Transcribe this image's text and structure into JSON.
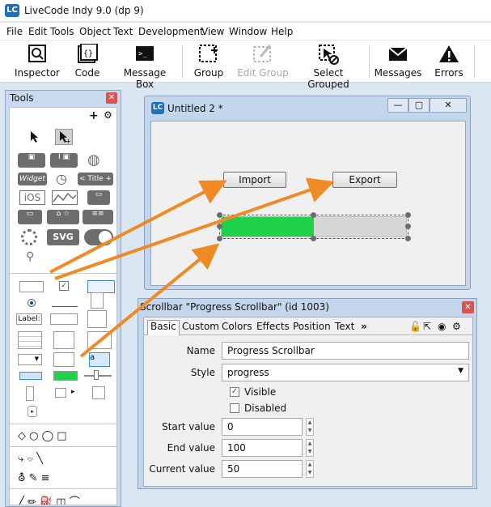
{
  "app": {
    "logo": "LC",
    "title": "LiveCode Indy 9.0 (dp 9)"
  },
  "menu": [
    "File",
    "Edit",
    "Tools",
    "Object",
    "Text",
    "Development",
    "View",
    "Window",
    "Help"
  ],
  "toolbar": [
    {
      "label": "Inspector",
      "icon": "inspector-icon",
      "enabled": true
    },
    {
      "label": "Code",
      "icon": "code-icon",
      "enabled": true
    },
    {
      "label": "Message Box",
      "icon": "message-box-icon",
      "enabled": true
    },
    {
      "label": "Group",
      "icon": "group-icon",
      "enabled": true
    },
    {
      "label": "Edit Group",
      "icon": "edit-group-icon",
      "enabled": false
    },
    {
      "label": "Select Grouped",
      "icon": "select-grouped-icon",
      "enabled": true
    },
    {
      "label": "Messages",
      "icon": "messages-icon",
      "enabled": true
    },
    {
      "label": "Errors",
      "icon": "errors-icon",
      "enabled": true
    }
  ],
  "tools": {
    "title": "Tools",
    "widget_label": "Widget",
    "title_label": "< Title +",
    "ios_label": "iOS",
    "svg_label": "SVG",
    "field_label": "Label:"
  },
  "stack": {
    "logo": "LC",
    "title": "Untitled 2 *",
    "import_label": "Import",
    "export_label": "Export",
    "progress": {
      "start": 0,
      "end": 100,
      "current": 50,
      "fill_color": "#1fd24a"
    }
  },
  "inspector": {
    "title": "Scrollbar \"Progress Scrollbar\" (id 1003)",
    "tabs": [
      "Basic",
      "Custom",
      "Colors",
      "Effects",
      "Position",
      "Text"
    ],
    "more_tabs": "»",
    "name_label": "Name",
    "name_value": "Progress Scrollbar",
    "style_label": "Style",
    "style_value": "progress",
    "visible_label": "Visible",
    "visible_checked": true,
    "disabled_label": "Disabled",
    "disabled_checked": false,
    "start_label": "Start value",
    "start_value": "0",
    "end_label": "End value",
    "end_value": "100",
    "current_label": "Current value",
    "current_value": "50"
  },
  "colors": {
    "accent": "#1f6fbf",
    "arrow": "#f08a24",
    "progress": "#1fd24a"
  }
}
